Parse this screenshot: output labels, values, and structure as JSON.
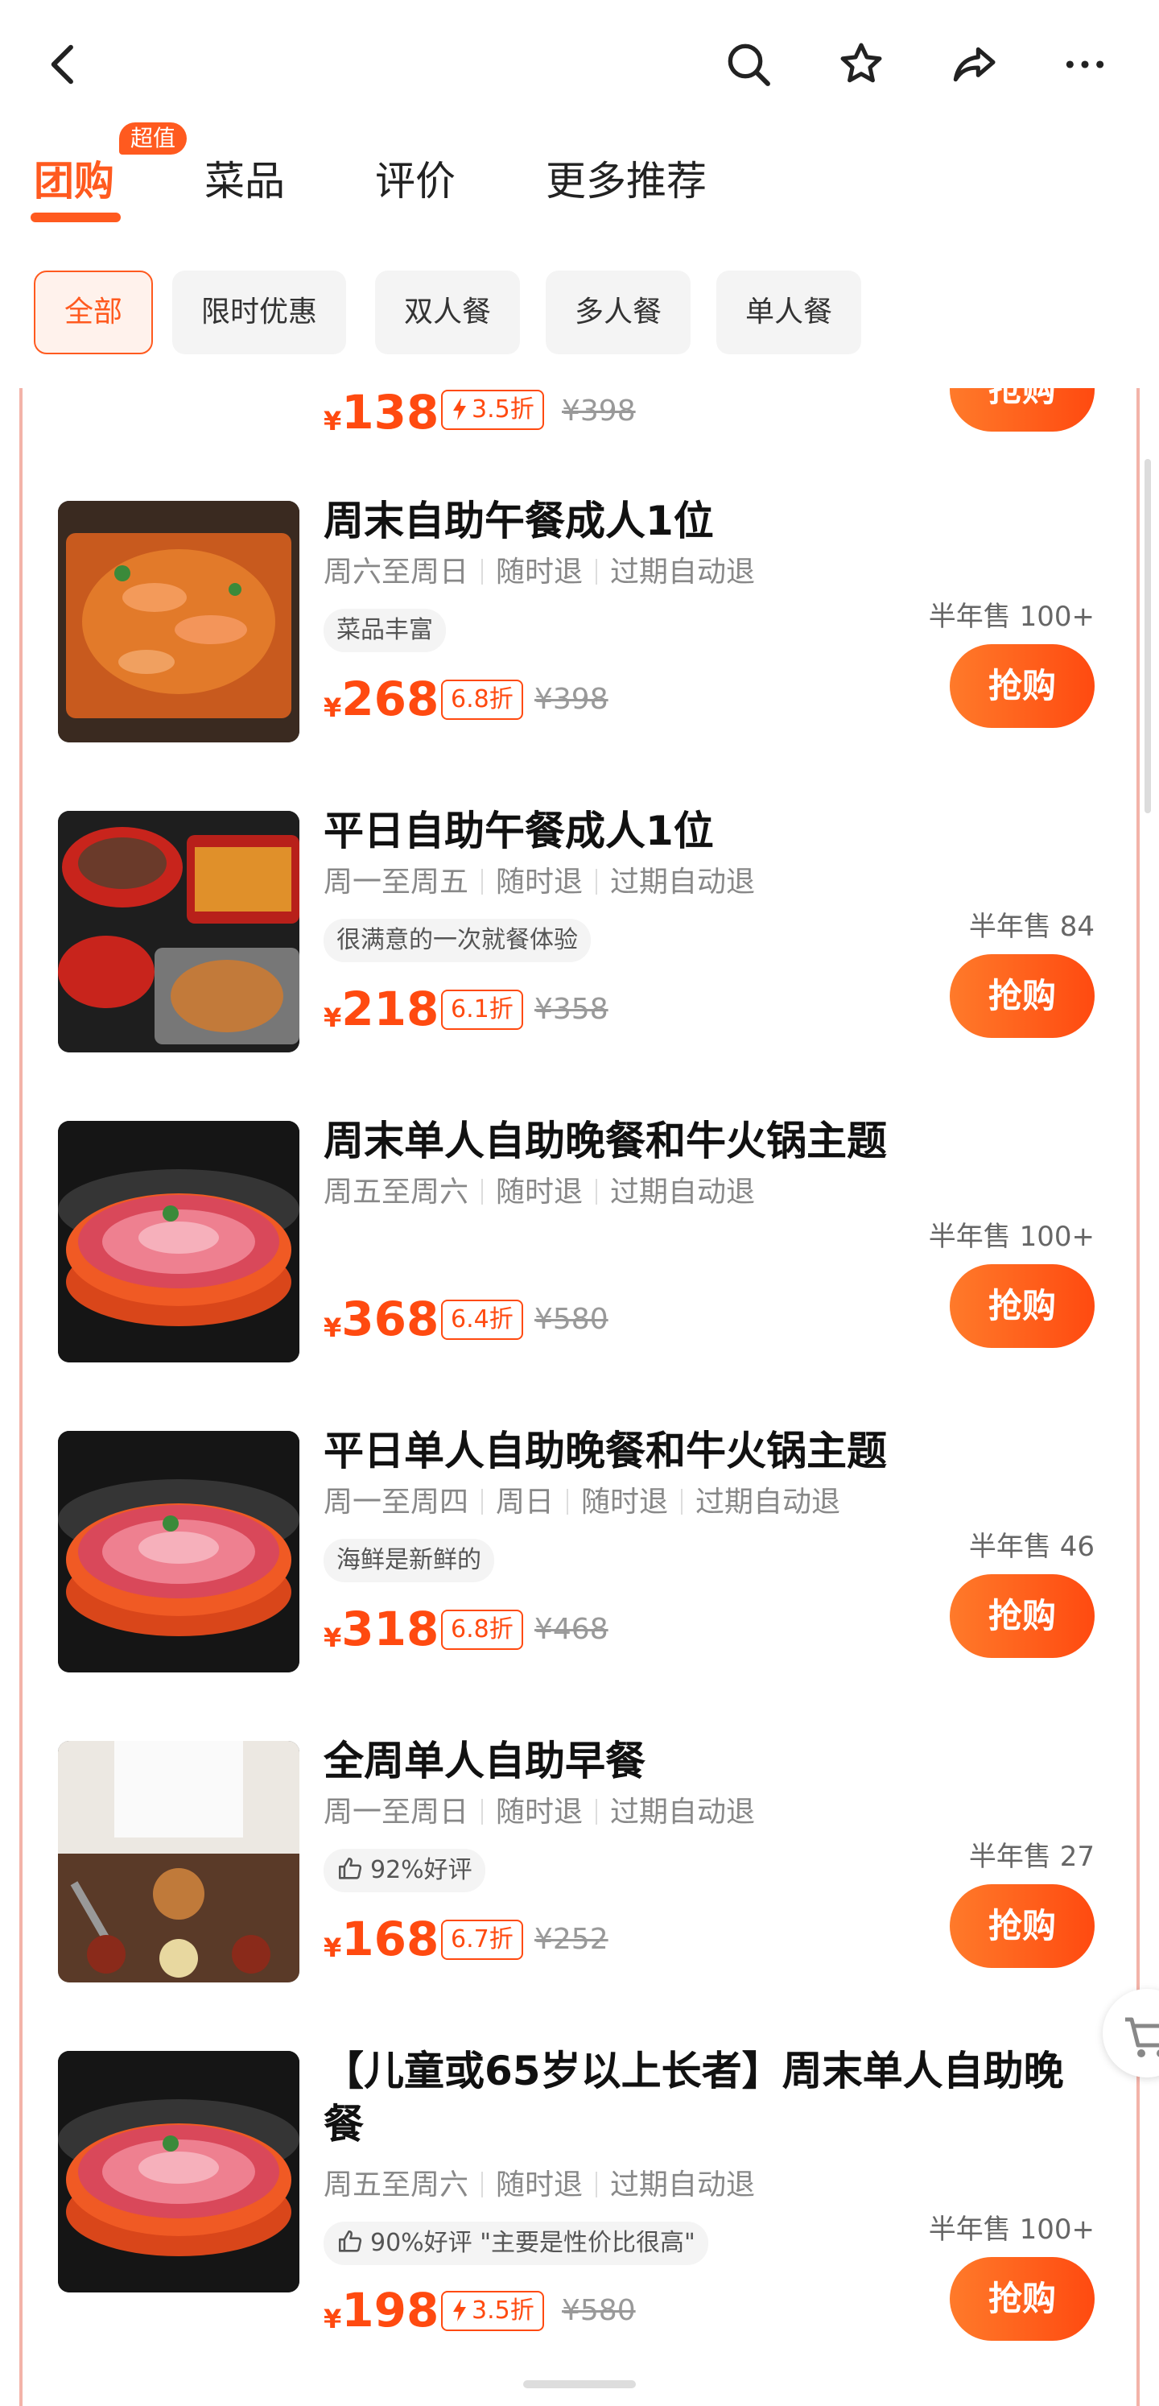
{
  "tabs": [
    {
      "label": "团购",
      "active": true
    },
    {
      "label": "菜品",
      "active": false
    },
    {
      "label": "评价",
      "active": false
    },
    {
      "label": "更多推荐",
      "active": false
    }
  ],
  "tab_badge": "超值",
  "filters": [
    "全部",
    "限时优惠",
    "双人餐",
    "多人餐",
    "单人餐"
  ],
  "buy_label": "抢购",
  "currency": "¥",
  "partial_item": {
    "price": "138",
    "discount": "3.5折",
    "original": "¥398"
  },
  "items": [
    {
      "title": "周末自助午餐成人1位",
      "meta": [
        "周六至周日",
        "随时退",
        "过期自动退"
      ],
      "tag": "菜品丰富",
      "price": "268",
      "discount": "6.8折",
      "original": "¥398",
      "sold": "半年售 100+"
    },
    {
      "title": "平日自助午餐成人1位",
      "meta": [
        "周一至周五",
        "随时退",
        "过期自动退"
      ],
      "tag": "很满意的一次就餐体验",
      "price": "218",
      "discount": "6.1折",
      "original": "¥358",
      "sold": "半年售 84"
    },
    {
      "title": "周末单人自助晚餐和牛火锅主题",
      "meta": [
        "周五至周六",
        "随时退",
        "过期自动退"
      ],
      "tag": "",
      "price": "368",
      "discount": "6.4折",
      "original": "¥580",
      "sold": "半年售 100+"
    },
    {
      "title": "平日单人自助晚餐和牛火锅主题",
      "meta": [
        "周一至周四",
        "周日",
        "随时退",
        "过期自动退"
      ],
      "tag": "海鲜是新鲜的",
      "price": "318",
      "discount": "6.8折",
      "original": "¥468",
      "sold": "半年售 46"
    },
    {
      "title": "全周单人自助早餐",
      "meta": [
        "周一至周日",
        "随时退",
        "过期自动退"
      ],
      "tag": "92%好评",
      "price": "168",
      "discount": "6.7折",
      "original": "¥252",
      "sold": "半年售 27"
    },
    {
      "title": "【儿童或65岁以上长者】周末单人自助晚餐",
      "meta": [
        "周五至周六",
        "随时退",
        "过期自动退"
      ],
      "tag": "90%好评 \"主要是性价比很高\"",
      "price": "198",
      "discount": "3.5折",
      "original": "¥580",
      "sold": "半年售 100+"
    }
  ],
  "colors": {
    "accent": "#ff5a1f",
    "price": "#ff4a10"
  },
  "icons": [
    "back-icon",
    "search-icon",
    "star-icon",
    "share-icon",
    "more-icon",
    "thumbs-up-icon",
    "bolt-icon",
    "cart-icon"
  ]
}
